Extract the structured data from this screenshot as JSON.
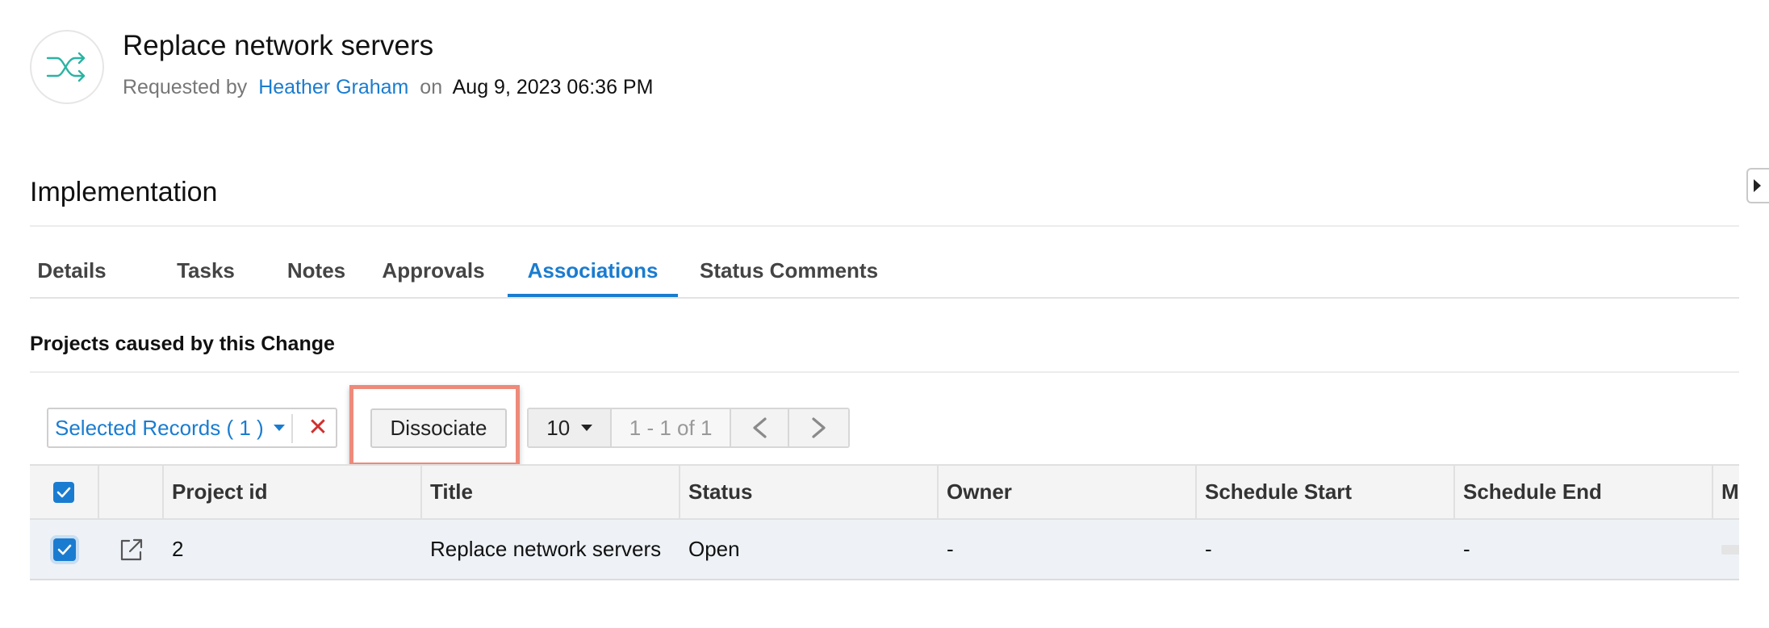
{
  "header": {
    "title": "Replace network servers",
    "requested_by_label": "Requested by",
    "requester": "Heather Graham",
    "on_label": "on",
    "requested_date": "Aug 9, 2023 06:36 PM",
    "icon": "shuffle-icon"
  },
  "section_title": "Implementation",
  "tabs": [
    {
      "label": "Details"
    },
    {
      "label": "Tasks"
    },
    {
      "label": "Notes"
    },
    {
      "label": "Approvals"
    },
    {
      "label": "Associations",
      "active": true
    },
    {
      "label": "Status Comments"
    }
  ],
  "subsection_title": "Projects caused by this Change",
  "toolbar": {
    "selected_records_label": "Selected Records ( 1 )",
    "clear_icon": "close-icon",
    "dissociate_label": "Dissociate",
    "page_size": "10",
    "page_range": "1 - 1 of 1",
    "prev_icon": "chevron-left-icon",
    "next_icon": "chevron-right-icon"
  },
  "table": {
    "columns": [
      "Project id",
      "Title",
      "Status",
      "Owner",
      "Schedule Start",
      "Schedule End",
      "Milestones"
    ],
    "rows": [
      {
        "selected": true,
        "project_id": "2",
        "title": "Replace network servers",
        "status": "Open",
        "owner": "-",
        "schedule_start": "-",
        "schedule_end": "-"
      }
    ]
  },
  "colors": {
    "accent": "#1a7cd0",
    "highlight": "#ee8a7a",
    "icon_teal": "#2bb3a3",
    "danger": "#d0302f"
  }
}
